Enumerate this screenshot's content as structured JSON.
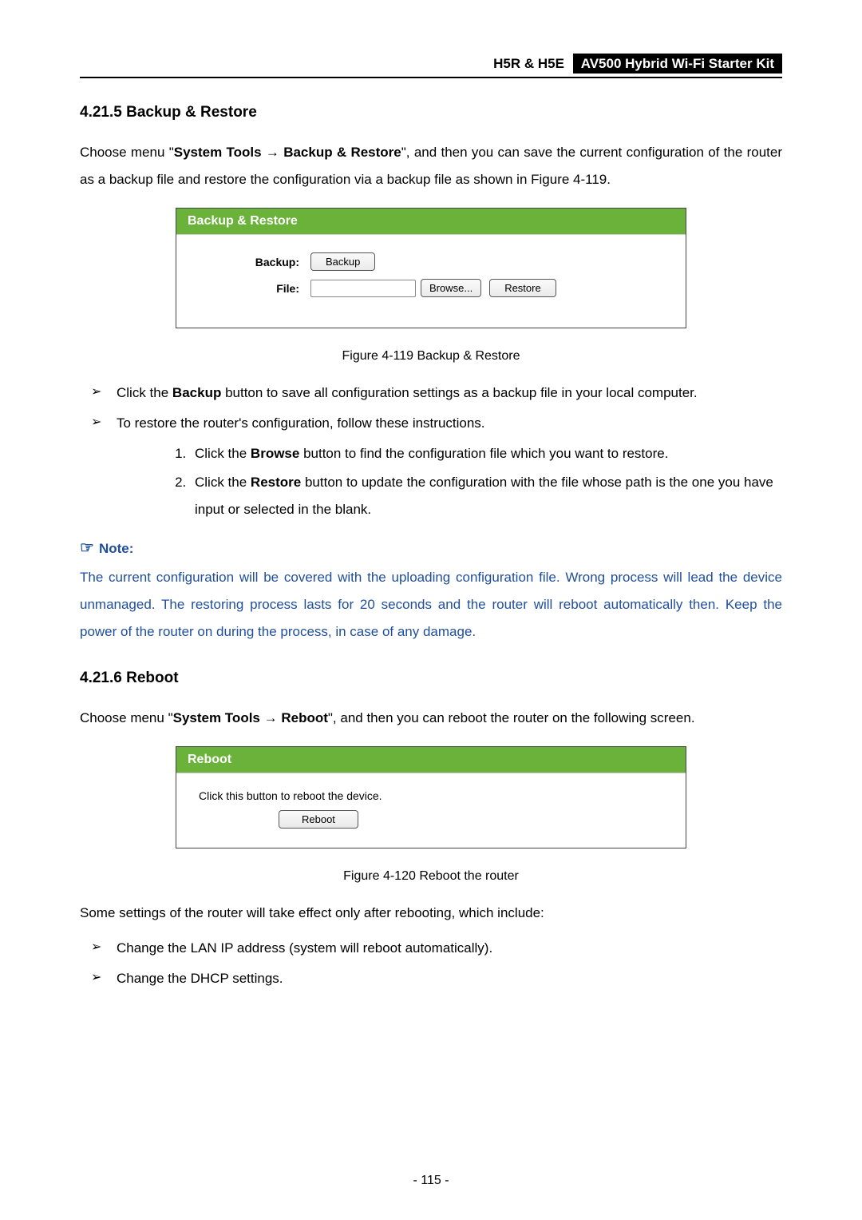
{
  "header": {
    "model": "H5R & H5E",
    "product": "AV500 Hybrid Wi-Fi Starter Kit"
  },
  "section1": {
    "title": "4.21.5  Backup & Restore",
    "intro_prefix": "Choose menu \"",
    "intro_menu1": "System Tools",
    "intro_arrow": " → ",
    "intro_menu2": "Backup & Restore",
    "intro_suffix": "\", and then you can save the current configuration of the router as a backup file and restore the configuration via a backup file as shown in Figure 4-119."
  },
  "fig1": {
    "panel_title": "Backup & Restore",
    "row_backup_label": "Backup:",
    "row_file_label": "File:",
    "btn_backup": "Backup",
    "btn_browse": "Browse...",
    "btn_restore": "Restore",
    "caption": "Figure 4-119 Backup & Restore"
  },
  "bullets1": {
    "b1_pre": "Click the ",
    "b1_bold": "Backup",
    "b1_post": " button to save all configuration settings as a backup file in your local computer.",
    "b2": "To restore the router's configuration, follow these instructions.",
    "n1_pre": "Click the ",
    "n1_bold": "Browse",
    "n1_post": " button to find the configuration file which you want to restore.",
    "n2_pre": "Click the ",
    "n2_bold": "Restore",
    "n2_post": " button to update the configuration with the file whose path is the one you have input or selected in the blank."
  },
  "note": {
    "label": "Note:",
    "body": "The current configuration will be covered with the uploading configuration file. Wrong process will lead the device unmanaged. The restoring process lasts for 20 seconds and the router will reboot automatically then. Keep the power of the router on during the process, in case of any damage."
  },
  "section2": {
    "title": "4.21.6  Reboot",
    "intro_prefix": "Choose menu \"",
    "intro_menu1": "System Tools",
    "intro_arrow": " → ",
    "intro_menu2": "Reboot",
    "intro_suffix": "\", and then you can reboot the router on the following screen."
  },
  "fig2": {
    "panel_title": "Reboot",
    "body_text": "Click this button to reboot the device.",
    "btn_reboot": "Reboot",
    "caption": "Figure 4-120 Reboot the router"
  },
  "tail": {
    "intro": "Some settings of the router will take effect only after rebooting, which include:",
    "b1": "Change the LAN IP address (system will reboot automatically).",
    "b2": "Change the DHCP settings."
  },
  "page_number": "- 115 -"
}
